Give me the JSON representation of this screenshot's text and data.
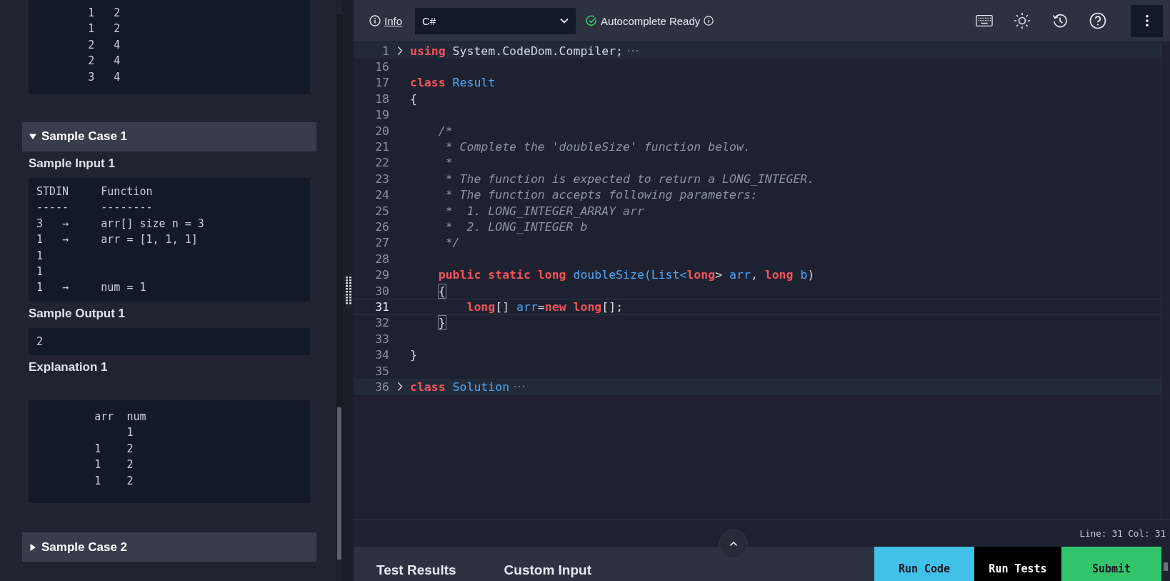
{
  "problem_panel": {
    "output_block": {
      "lines": [
        "        1   2",
        "        1   2",
        "        2   4",
        "        2   4",
        "        3   4"
      ]
    },
    "cases": [
      {
        "title": "Sample Case 1",
        "expanded": true,
        "sections": [
          {
            "kind": "block",
            "heading": "Sample Input 1",
            "lines": [
              "STDIN     Function",
              "-----     --------",
              "3   →     arr[] size n = 3",
              "1   →     arr = [1, 1, 1]",
              "1",
              "1",
              "1   →     num = 1"
            ]
          },
          {
            "kind": "block",
            "heading": "Sample Output 1",
            "lines": [
              "2"
            ]
          },
          {
            "kind": "explanation",
            "heading": "Explanation 1",
            "lines": [
              "         arr  num",
              "              1",
              "         1    2",
              "         1    2",
              "         1    2"
            ]
          }
        ]
      },
      {
        "title": "Sample Case 2",
        "expanded": false
      }
    ]
  },
  "toolbar": {
    "info_link": "Info",
    "language": "C#",
    "autocomplete": {
      "label": "Autocomplete Ready",
      "ready": true
    }
  },
  "editor": {
    "lines": [
      {
        "number": "1",
        "folded": true,
        "current": false,
        "tokens": [
          {
            "kind": "keyword",
            "text": "using"
          },
          {
            "kind": "plain",
            "text": " System.CodeDom.Compiler;"
          }
        ]
      },
      {
        "number": "16",
        "folded": false,
        "current": false
      },
      {
        "number": "17",
        "folded": false,
        "current": false,
        "tokens": [
          {
            "kind": "keyword",
            "text": "class"
          },
          {
            "kind": "name",
            "text": " Result"
          }
        ]
      },
      {
        "number": "18",
        "folded": false,
        "current": false,
        "tokens": [
          {
            "kind": "plain",
            "text": "{"
          }
        ]
      },
      {
        "number": "19",
        "folded": false,
        "current": false
      },
      {
        "number": "20",
        "folded": false,
        "current": false,
        "tokens": [
          {
            "kind": "comment",
            "text": "    /*"
          }
        ]
      },
      {
        "number": "21",
        "folded": false,
        "current": false,
        "tokens": [
          {
            "kind": "comment",
            "text": "     * Complete the 'doubleSize' function below."
          }
        ]
      },
      {
        "number": "22",
        "folded": false,
        "current": false,
        "tokens": [
          {
            "kind": "comment",
            "text": "     *"
          }
        ]
      },
      {
        "number": "23",
        "folded": false,
        "current": false,
        "tokens": [
          {
            "kind": "comment",
            "text": "     * The function is expected to return a LONG_INTEGER."
          }
        ]
      },
      {
        "number": "24",
        "folded": false,
        "current": false,
        "tokens": [
          {
            "kind": "comment",
            "text": "     * The function accepts following parameters:"
          }
        ]
      },
      {
        "number": "25",
        "folded": false,
        "current": false,
        "tokens": [
          {
            "kind": "comment",
            "text": "     *  1. LONG_INTEGER_ARRAY arr"
          }
        ]
      },
      {
        "number": "26",
        "folded": false,
        "current": false,
        "tokens": [
          {
            "kind": "comment",
            "text": "     *  2. LONG_INTEGER b"
          }
        ]
      },
      {
        "number": "27",
        "folded": false,
        "current": false,
        "tokens": [
          {
            "kind": "comment",
            "text": "     */"
          }
        ]
      },
      {
        "number": "28",
        "folded": false,
        "current": false
      },
      {
        "number": "29",
        "folded": false,
        "current": false,
        "tokens": [
          {
            "kind": "keyword",
            "text": "    public static long"
          },
          {
            "kind": "name",
            "text": " doubleSize(List<"
          },
          {
            "kind": "keyword",
            "text": "long"
          },
          {
            "kind": "plain",
            "text": "> "
          },
          {
            "kind": "name",
            "text": "arr"
          },
          {
            "kind": "plain",
            "text": ", "
          },
          {
            "kind": "keyword",
            "text": "long"
          },
          {
            "kind": "name",
            "text": " b"
          },
          {
            "kind": "plain",
            "text": ")"
          }
        ]
      },
      {
        "number": "30",
        "folded": false,
        "current": false,
        "tokens": [
          {
            "kind": "bracket",
            "text": "    {"
          }
        ]
      },
      {
        "number": "31",
        "folded": false,
        "current": true,
        "tokens": [
          {
            "kind": "keyword",
            "text": "        long"
          },
          {
            "kind": "plain",
            "text": "[] "
          },
          {
            "kind": "name",
            "text": "arr"
          },
          {
            "kind": "plain",
            "text": "="
          },
          {
            "kind": "keyword",
            "text": "new long"
          },
          {
            "kind": "plain",
            "text": "[];"
          }
        ]
      },
      {
        "number": "32",
        "folded": false,
        "current": false,
        "tokens": [
          {
            "kind": "bracket",
            "text": "    }"
          }
        ]
      },
      {
        "number": "33",
        "folded": false,
        "current": false
      },
      {
        "number": "34",
        "folded": false,
        "current": false,
        "tokens": [
          {
            "kind": "plain",
            "text": "}"
          }
        ]
      },
      {
        "number": "35",
        "folded": false,
        "current": false
      },
      {
        "number": "36",
        "folded": true,
        "current": false,
        "tokens": [
          {
            "kind": "keyword",
            "text": "class"
          },
          {
            "kind": "name",
            "text": " Solution"
          }
        ]
      }
    ]
  },
  "status_bar": {
    "position": "Line: 31 Col: 31"
  },
  "bottom_bar": {
    "tabs": [
      "Test Results",
      "Custom Input"
    ],
    "buttons": [
      {
        "label": "Run Code",
        "color": "#41c0e8"
      },
      {
        "label": "Run Tests",
        "color": "#000000"
      },
      {
        "label": "Submit",
        "color": "#32c46a"
      }
    ]
  }
}
